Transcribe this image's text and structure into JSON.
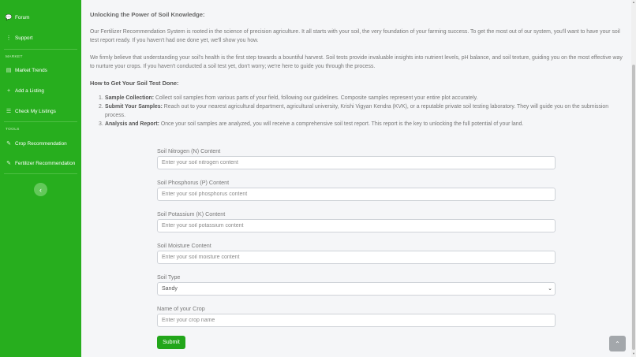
{
  "sidebar": {
    "items_top": [
      {
        "label": "Forum",
        "icon": "forum-icon",
        "glyph": "💬"
      },
      {
        "label": "Support",
        "icon": "support-icon",
        "glyph": "⋮"
      }
    ],
    "market_heading": "MARKET",
    "market_items": [
      {
        "label": "Market Trends",
        "icon": "market-trends-icon",
        "glyph": "▤"
      },
      {
        "label": "Add a Listing",
        "icon": "plus-icon",
        "glyph": "+"
      },
      {
        "label": "Check My Listings",
        "icon": "list-icon",
        "glyph": "☰"
      }
    ],
    "tools_heading": "TOOLS",
    "tools_items": [
      {
        "label": "Crop Recommendation",
        "icon": "wrench-icon",
        "glyph": "✎"
      },
      {
        "label": "Fertilizer Recommendation",
        "icon": "wrench-icon",
        "glyph": "✎"
      }
    ],
    "collapse_glyph": "‹"
  },
  "main": {
    "title": "Unlocking the Power of Soil Knowledge:",
    "para1": "Our Fertilizer Recommendation System is rooted in the science of precision agriculture. It all starts with your soil, the very foundation of your farming success. To get the most out of our system, you'll want to have your soil test report ready. If you haven't had one done yet, we'll show you how.",
    "para2": "We firmly believe that understanding your soil's health is the first step towards a bountiful harvest. Soil tests provide invaluable insights into nutrient levels, pH balance, and soil texture, guiding you on the most effective way to nurture your crops. If you haven't conducted a soil test yet, don't worry; we're here to guide you through the process.",
    "subtitle": "How to Get Your Soil Test Done:",
    "steps": [
      {
        "num": "1.",
        "bold": "Sample Collection:",
        "text": " Collect soil samples from various parts of your field, following our guidelines. Composite samples represent your entire plot accurately."
      },
      {
        "num": "2.",
        "bold": "Submit Your Samples:",
        "text": " Reach out to your nearest agricultural department, agricultural university, Krishi Vigyan Kendra (KVK), or a reputable private soil testing laboratory. They will guide you on the submission process."
      },
      {
        "num": "3.",
        "bold": "Analysis and Report:",
        "text": " Once your soil samples are analyzed, you will receive a comprehensive soil test report. This report is the key to unlocking the full potential of your land."
      }
    ]
  },
  "form": {
    "nitrogen": {
      "label": "Soil Nitrogen (N) Content",
      "placeholder": "Enter your soil nitrogen content",
      "value": ""
    },
    "phosphorus": {
      "label": "Soil Phosphorus (P) Content",
      "placeholder": "Enter your soil phosphorus content",
      "value": ""
    },
    "potassium": {
      "label": "Soil Potassium (K) Content",
      "placeholder": "Enter your soil potassium content",
      "value": ""
    },
    "moisture": {
      "label": "Soil Moisture Content",
      "placeholder": "Enter your soil moisture content",
      "value": ""
    },
    "soil_type": {
      "label": "Soil Type",
      "selected": "Sandy",
      "chevron": "⌄"
    },
    "crop": {
      "label": "Name of your Crop",
      "placeholder": "Enter your crop name",
      "value": ""
    },
    "submit_label": "Submit"
  },
  "back_to_top_glyph": "⌃",
  "colors": {
    "sidebar": "#27ae1e",
    "accent": "#22a61a",
    "background": "#f5f6f8"
  }
}
